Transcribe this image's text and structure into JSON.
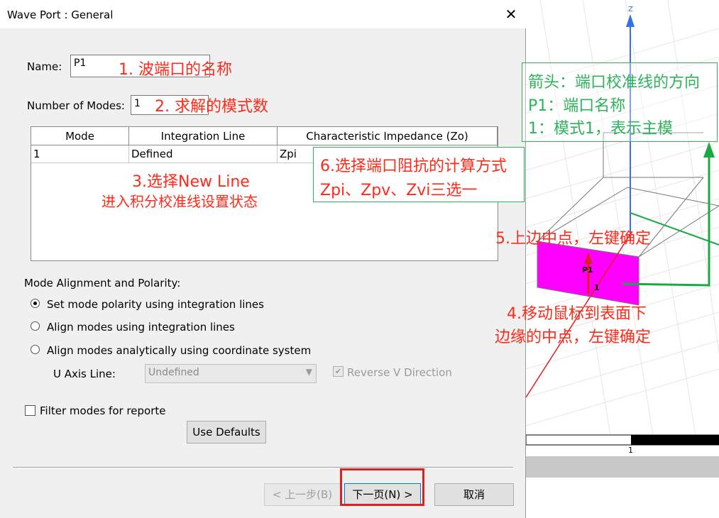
{
  "dialog": {
    "title": "Wave Port : General",
    "close_glyph": "✕",
    "name_label": "Name:",
    "name_value": "P1",
    "modes_label": "Number of Modes:",
    "modes_value": "1",
    "table": {
      "headers": [
        "Mode",
        "Integration Line",
        "Characteristic Impedance (Zo)"
      ],
      "rows": [
        [
          "1",
          "Defined",
          "Zpi"
        ]
      ]
    },
    "alignment_label": "Mode Alignment and Polarity:",
    "radios": [
      {
        "label": "Set mode polarity using integration lines",
        "selected": true
      },
      {
        "label": "Align modes using integration lines",
        "selected": false
      },
      {
        "label": "Align modes analytically using coordinate system",
        "selected": false
      }
    ],
    "u_axis_label": "U Axis Line:",
    "u_axis_value": "Undefined",
    "reverse_v_label": "Reverse V Direction",
    "filter_label": "Filter modes for reporter",
    "use_defaults": "Use Defaults",
    "back_button": "< 上一步(B)",
    "next_button": "下一页(N) >",
    "cancel_button": "取消"
  },
  "annotations": {
    "a1": "1. 波端口的名称",
    "a2": "2. 求解的模式数",
    "a3_line1": "3.选择New Line",
    "a3_line2": "进入积分校准线设置状态",
    "a4_line1": "4.移动鼠标到表面下",
    "a4_line2": "边缘的中点，左键确定",
    "a5": "5.上边中点，左键确定",
    "a6_line1": "6.选择端口阻抗的计算方式",
    "a6_line2": "Zpi、Zpv、Zvi三选一",
    "green_line1": "箭头：端口校准线的方向",
    "green_line2": "P1：端口名称",
    "green_line3": "1：模式1，表示主模"
  },
  "viewport": {
    "axis_z": "Z",
    "port_label": "P1",
    "mode_label": "1",
    "scale_label": "1",
    "colors": {
      "port_fill": "#ff00ff",
      "axis_blue": "#3a6fe0",
      "axis_green": "#1aaa44",
      "axis_red": "#e02020",
      "annotation_red": "#ff2a1a",
      "annotation_green": "#2eb35a",
      "highlight_box": "#e02020"
    }
  }
}
